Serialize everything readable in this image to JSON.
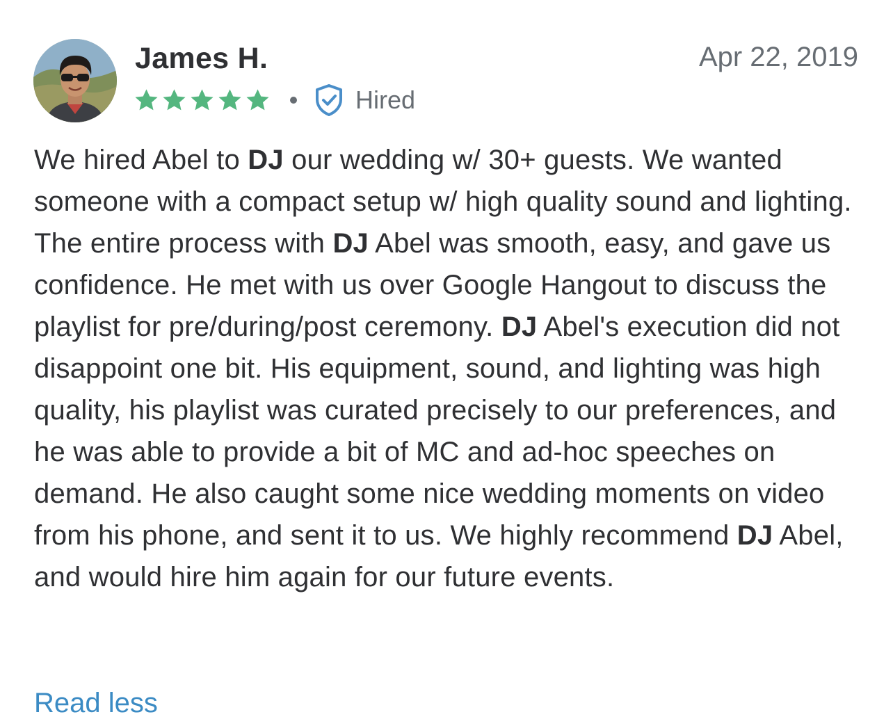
{
  "review": {
    "reviewer_name": "James H.",
    "date": "Apr 22, 2019",
    "rating": 5,
    "rating_max": 5,
    "star_color": "#54b67f",
    "hired_label": "Hired",
    "hired_icon": "shield-check-icon",
    "hired_icon_color": "#4a8ec9",
    "body_segments": [
      {
        "text": "We hired Abel to ",
        "bold": false
      },
      {
        "text": "DJ",
        "bold": true
      },
      {
        "text": " our wedding w/ 30+ guests. We wanted someone with a compact setup w/ high quality sound and lighting. The entire process with ",
        "bold": false
      },
      {
        "text": "DJ",
        "bold": true
      },
      {
        "text": " Abel was smooth, easy, and gave us confidence. He met with us over Google Hangout to discuss the playlist for pre/during/post ceremony. ",
        "bold": false
      },
      {
        "text": "DJ",
        "bold": true
      },
      {
        "text": " Abel's execution did not disappoint one bit. His equipment, sound, and lighting was high quality, his playlist was curated precisely to our preferences, and he was able to provide a bit of MC and ad-hoc speeches on demand. He also caught some nice wedding moments on video from his phone, and sent it to us. We highly recommend ",
        "bold": false
      },
      {
        "text": "DJ",
        "bold": true
      },
      {
        "text": " Abel, and would hire him again for our future events.",
        "bold": false
      }
    ],
    "read_less_label": "Read less",
    "link_color": "#3b8bc4"
  }
}
